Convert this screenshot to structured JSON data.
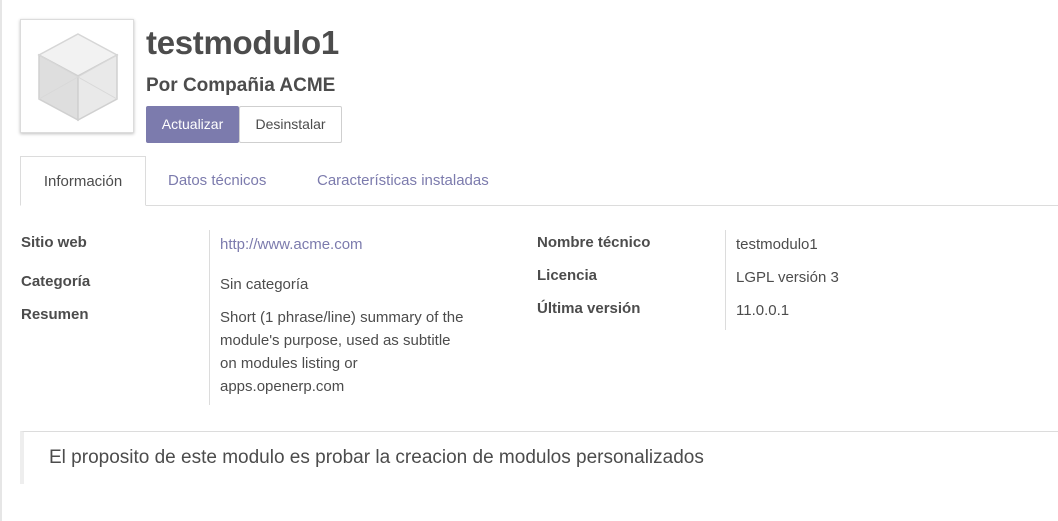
{
  "module": {
    "name": "testmodulo1",
    "author": "Por Compañia ACME",
    "image_icon": "cube-icon"
  },
  "actions": {
    "update_label": "Actualizar",
    "uninstall_label": "Desinstalar"
  },
  "tabs": [
    {
      "label": "Información",
      "active": true
    },
    {
      "label": "Datos técnicos",
      "active": false
    },
    {
      "label": "Características instaladas",
      "active": false
    }
  ],
  "info": {
    "website_label": "Sitio web",
    "website_value": "http://www.acme.com",
    "category_label": "Categoría",
    "category_value": "Sin categoría",
    "summary_label": "Resumen",
    "summary_lines": [
      "Short (1 phrase/line) summary of the",
      "module's purpose, used as subtitle",
      "on modules listing or",
      "apps.openerp.com"
    ],
    "technical_name_label": "Nombre técnico",
    "technical_name_value": "testmodulo1",
    "license_label": "Licencia",
    "license_value": "LGPL versión 3",
    "latest_version_label": "Última versión",
    "latest_version_value": "11.0.0.1"
  },
  "description": "El proposito de este modulo es probar la creacion de modulos personalizados",
  "colors": {
    "accent": "#7c7bad",
    "text": "#4c4c4c",
    "border": "#dcdcdc"
  }
}
